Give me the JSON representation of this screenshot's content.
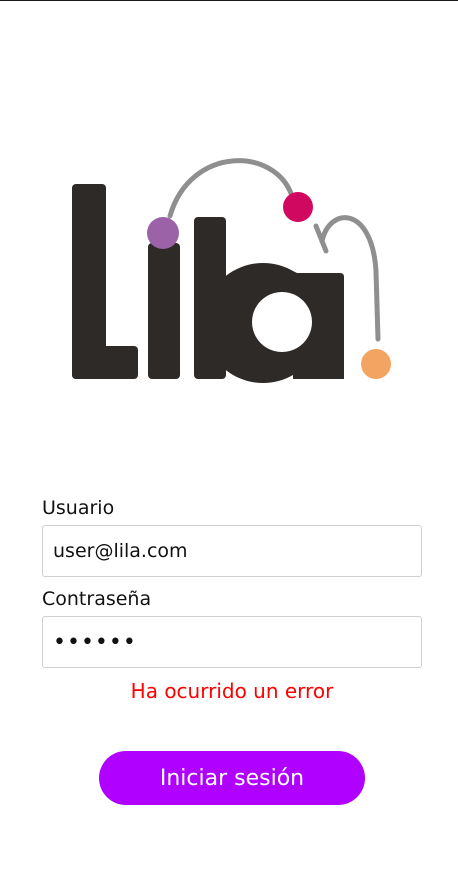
{
  "brand": {
    "logo_text": "Lila",
    "colors": {
      "letters": "#2e2a27",
      "arc": "#8f8f8f",
      "dot_purple": "#9b62a7",
      "dot_magenta": "#d1085f",
      "dot_orange": "#f4a462"
    }
  },
  "form": {
    "user_label": "Usuario",
    "user_value": "user@lila.com",
    "password_label": "Contraseña",
    "password_value": "••••••",
    "error_message": "Ha ocurrido un error",
    "submit_label": "Iniciar sesión"
  },
  "colors": {
    "error": "#ff0000",
    "primary_button": "#b000ff"
  }
}
